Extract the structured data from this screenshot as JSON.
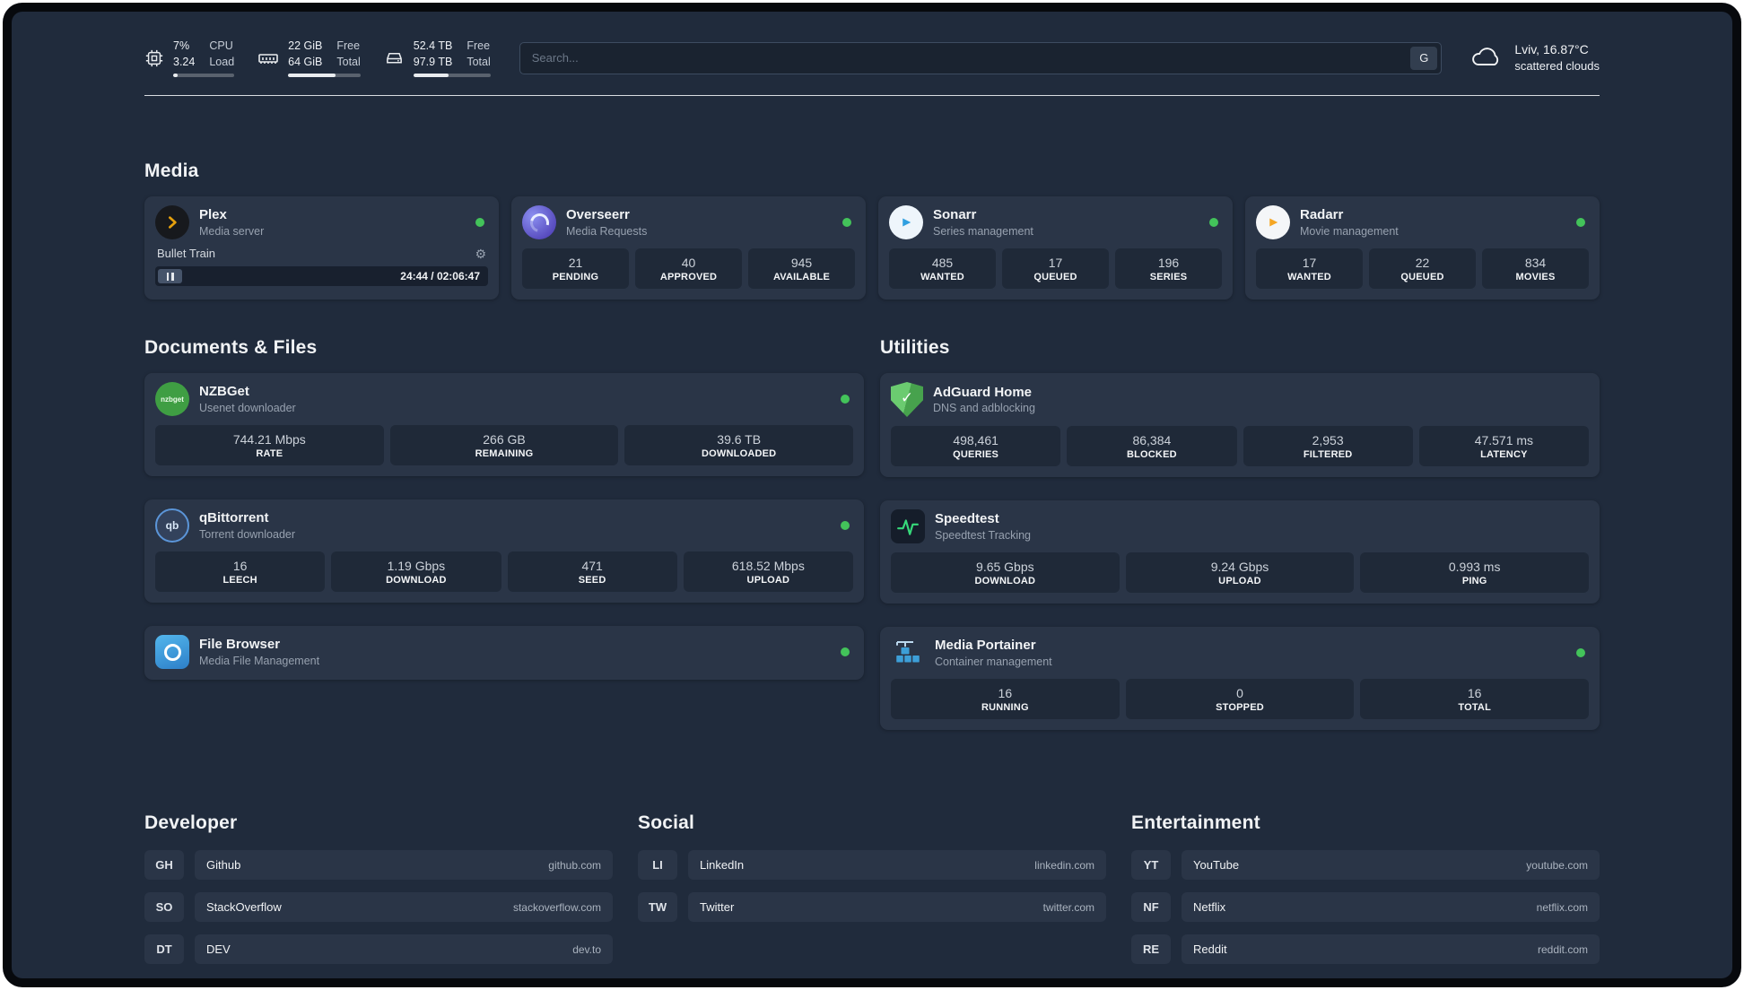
{
  "colors": {
    "status_online": "#43c35a",
    "plex_accent": "#e5a00d",
    "sonarr_accent": "#2f9fe0",
    "radarr_accent": "#f5a623",
    "overseerr_accent": "#5a4fc4",
    "adguard_accent": "#57b25c",
    "speedtest_line": "#36d97a",
    "portainer_accent": "#3d9fd8",
    "filebrowser_accent": "#3e9bdc",
    "nzbget_accent": "#3f9e43"
  },
  "header": {
    "metrics": [
      {
        "name": "cpu",
        "values": [
          "7%",
          "3.24"
        ],
        "labels": [
          "CPU",
          "Load"
        ],
        "progress": 7
      },
      {
        "name": "memory",
        "values": [
          "22 GiB",
          "64 GiB"
        ],
        "labels": [
          "Free",
          "Total"
        ],
        "progress": 66
      },
      {
        "name": "disk",
        "values": [
          "52.4 TB",
          "97.9 TB"
        ],
        "labels": [
          "Free",
          "Total"
        ],
        "progress": 46
      }
    ],
    "search": {
      "placeholder": "Search...",
      "engine_label": "G"
    },
    "weather": {
      "location": "Lviv, 16.87°C",
      "condition": "scattered clouds"
    }
  },
  "sections": {
    "media": {
      "title": "Media"
    },
    "documents": {
      "title": "Documents & Files"
    },
    "utilities": {
      "title": "Utilities"
    }
  },
  "apps": {
    "plex": {
      "name": "Plex",
      "subtitle": "Media server",
      "player": {
        "title": "Bullet Train",
        "time": "24:44 / 02:06:47"
      }
    },
    "overseerr": {
      "name": "Overseerr",
      "subtitle": "Media Requests",
      "stats": [
        {
          "value": "21",
          "label": "PENDING"
        },
        {
          "value": "40",
          "label": "APPROVED"
        },
        {
          "value": "945",
          "label": "AVAILABLE"
        }
      ]
    },
    "sonarr": {
      "name": "Sonarr",
      "subtitle": "Series management",
      "stats": [
        {
          "value": "485",
          "label": "WANTED"
        },
        {
          "value": "17",
          "label": "QUEUED"
        },
        {
          "value": "196",
          "label": "SERIES"
        }
      ]
    },
    "radarr": {
      "name": "Radarr",
      "subtitle": "Movie management",
      "stats": [
        {
          "value": "17",
          "label": "WANTED"
        },
        {
          "value": "22",
          "label": "QUEUED"
        },
        {
          "value": "834",
          "label": "MOVIES"
        }
      ]
    },
    "nzbget": {
      "name": "NZBGet",
      "subtitle": "Usenet downloader",
      "icon_text": "nzbget",
      "stats": [
        {
          "value": "744.21 Mbps",
          "label": "RATE"
        },
        {
          "value": "266 GB",
          "label": "REMAINING"
        },
        {
          "value": "39.6 TB",
          "label": "DOWNLOADED"
        }
      ]
    },
    "qbittorrent": {
      "name": "qBittorrent",
      "subtitle": "Torrent downloader",
      "icon_text": "qb",
      "stats": [
        {
          "value": "16",
          "label": "LEECH"
        },
        {
          "value": "1.19 Gbps",
          "label": "DOWNLOAD"
        },
        {
          "value": "471",
          "label": "SEED"
        },
        {
          "value": "618.52 Mbps",
          "label": "UPLOAD"
        }
      ]
    },
    "filebrowser": {
      "name": "File Browser",
      "subtitle": "Media File Management"
    },
    "adguard": {
      "name": "AdGuard Home",
      "subtitle": "DNS and adblocking",
      "icon_check": "✓",
      "stats": [
        {
          "value": "498,461",
          "label": "QUERIES"
        },
        {
          "value": "86,384",
          "label": "BLOCKED"
        },
        {
          "value": "2,953",
          "label": "FILTERED"
        },
        {
          "value": "47.571 ms",
          "label": "LATENCY"
        }
      ]
    },
    "speedtest": {
      "name": "Speedtest",
      "subtitle": "Speedtest Tracking",
      "stats": [
        {
          "value": "9.65 Gbps",
          "label": "DOWNLOAD"
        },
        {
          "value": "9.24 Gbps",
          "label": "UPLOAD"
        },
        {
          "value": "0.993 ms",
          "label": "PING"
        }
      ]
    },
    "portainer": {
      "name": "Media Portainer",
      "subtitle": "Container management",
      "stats": [
        {
          "value": "16",
          "label": "RUNNING"
        },
        {
          "value": "0",
          "label": "STOPPED"
        },
        {
          "value": "16",
          "label": "TOTAL"
        }
      ]
    }
  },
  "bookmarks": [
    {
      "title": "Developer",
      "items": [
        {
          "abbr": "GH",
          "name": "Github",
          "url": "github.com"
        },
        {
          "abbr": "SO",
          "name": "StackOverflow",
          "url": "stackoverflow.com"
        },
        {
          "abbr": "DT",
          "name": "DEV",
          "url": "dev.to"
        }
      ]
    },
    {
      "title": "Social",
      "items": [
        {
          "abbr": "LI",
          "name": "LinkedIn",
          "url": "linkedin.com"
        },
        {
          "abbr": "TW",
          "name": "Twitter",
          "url": "twitter.com"
        }
      ]
    },
    {
      "title": "Entertainment",
      "items": [
        {
          "abbr": "YT",
          "name": "YouTube",
          "url": "youtube.com"
        },
        {
          "abbr": "NF",
          "name": "Netflix",
          "url": "netflix.com"
        },
        {
          "abbr": "RE",
          "name": "Reddit",
          "url": "reddit.com"
        }
      ]
    }
  ]
}
